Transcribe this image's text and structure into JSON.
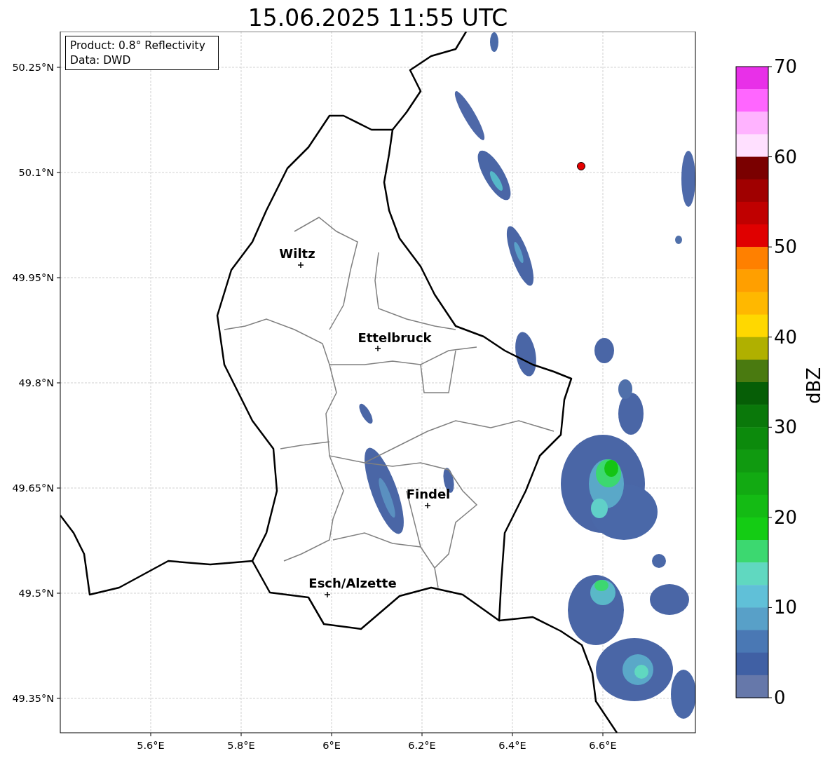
{
  "title": "15.06.2025 11:55 UTC",
  "info_box": {
    "lines": [
      "Product: 0.8° Reflectivity",
      "Data: DWD"
    ]
  },
  "map": {
    "latitude_labels": [
      "50.25°N",
      "50.1°N",
      "49.95°N",
      "49.8°N",
      "49.65°N",
      "49.5°N",
      "49.35°N"
    ],
    "longitude_labels": [
      "5.6°E",
      "5.8°E",
      "6°E",
      "6.2°E",
      "6.4°E",
      "6.6°E"
    ],
    "places": [
      {
        "name": "Wiltz"
      },
      {
        "name": "Ettelbruck"
      },
      {
        "name": "Findel"
      },
      {
        "name": "Esch/Alzette"
      }
    ]
  },
  "colorbar": {
    "label": "dBZ",
    "ticks": [
      "70",
      "60",
      "50",
      "40",
      "30",
      "20",
      "10",
      "0"
    ]
  }
}
